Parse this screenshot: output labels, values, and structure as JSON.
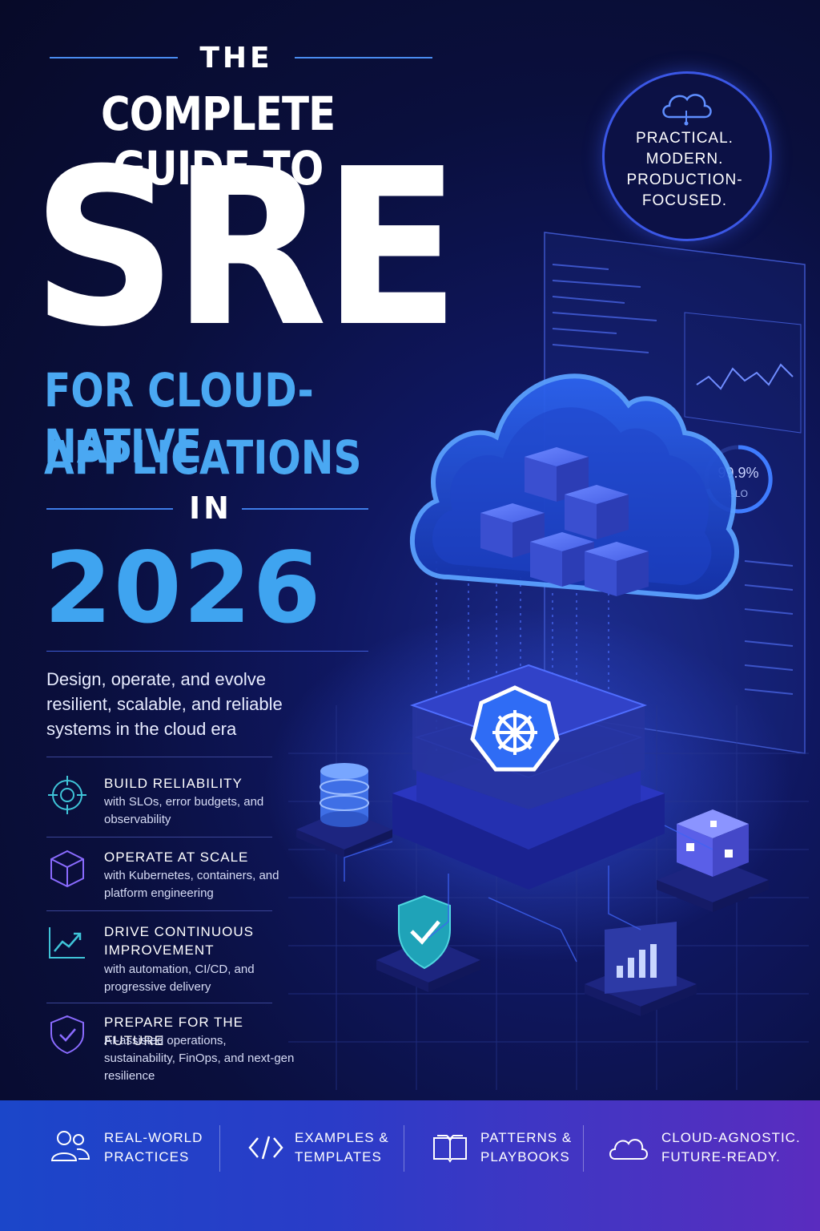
{
  "title": {
    "line1": "THE",
    "line2": "COMPLETE GUIDE TO",
    "main": "SRE",
    "line4": "FOR CLOUD-NATIVE",
    "line5": "APPLICATIONS",
    "line6": "IN",
    "year": "2026"
  },
  "tagline": "Design, operate, and evolve resilient, scalable, and reliable systems in the cloud era",
  "badge": {
    "icon": "cloud-icon",
    "text": "PRACTICAL. MODERN. PRODUCTION-FOCUSED."
  },
  "features": [
    {
      "icon": "target-icon",
      "heading": "BUILD RELIABILITY",
      "body": "with SLOs, error budgets, and observability"
    },
    {
      "icon": "cube-icon",
      "heading": "OPERATE AT SCALE",
      "body": "with Kubernetes, containers, and platform engineering"
    },
    {
      "icon": "trend-chart-icon",
      "heading": "DRIVE CONTINUOUS IMPROVEMENT",
      "body": "with automation, CI/CD, and progressive delivery"
    },
    {
      "icon": "shield-check-icon",
      "heading": "PREPARE FOR THE FUTURE",
      "body": "AI-assisted operations, sustainability, FinOps, and next-gen resilience"
    }
  ],
  "illustration": {
    "slo_value": "99.9%",
    "slo_label": "SLO"
  },
  "footer": [
    {
      "icon": "people-icon",
      "label": "REAL-WORLD PRACTICES"
    },
    {
      "icon": "code-icon",
      "label": "EXAMPLES & TEMPLATES"
    },
    {
      "icon": "book-icon",
      "label": "PATTERNS & PLAYBOOKS"
    },
    {
      "icon": "cloud-icon",
      "label": "CLOUD-AGNOSTIC. FUTURE-READY."
    }
  ],
  "colors": {
    "background": "#0a0f3d",
    "accent_blue": "#3fa4f0",
    "badge_border": "#3b57e6",
    "footer_start": "#1b46c9",
    "footer_end": "#5a2cbf"
  }
}
